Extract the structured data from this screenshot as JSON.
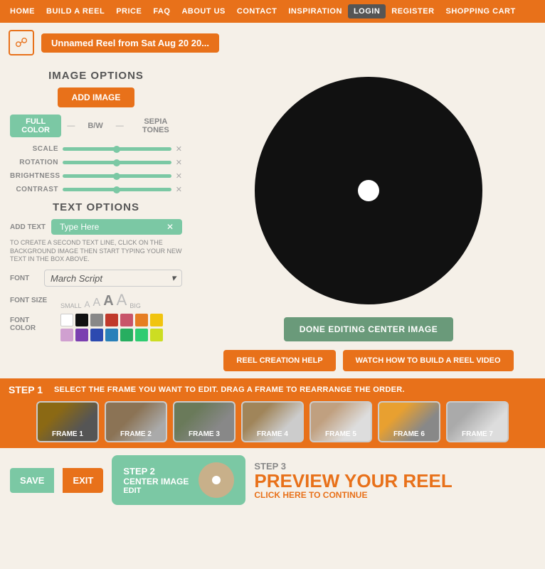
{
  "nav": {
    "items": [
      {
        "label": "HOME",
        "active": false
      },
      {
        "label": "BUILD A REEL",
        "active": false
      },
      {
        "label": "PRICE",
        "active": false
      },
      {
        "label": "FAQ",
        "active": false
      },
      {
        "label": "ABOUT US",
        "active": false
      },
      {
        "label": "CONTACT",
        "active": false
      },
      {
        "label": "INSPIRATION",
        "active": false
      },
      {
        "label": "LOGIN",
        "active": true
      },
      {
        "label": "REGISTER",
        "active": false
      },
      {
        "label": "SHOPPING CART",
        "active": false
      }
    ]
  },
  "top_bar": {
    "reel_title": "Unnamed Reel from Sat Aug 20 20..."
  },
  "left_panel": {
    "image_options_title": "IMAGE OPTIONS",
    "add_image_label": "ADD IMAGE",
    "color_options": {
      "full_color": "FULL COLOR",
      "bw": "B/W",
      "sepia": "SEPIA TONES"
    },
    "sliders": [
      {
        "label": "SCALE"
      },
      {
        "label": "ROTATION"
      },
      {
        "label": "BRIGHTNESS"
      },
      {
        "label": "CONTRAST"
      }
    ],
    "text_options_title": "TEXT OPTIONS",
    "add_text_label": "ADD TEXT",
    "type_here_placeholder": "Type Here",
    "hint": "TO CREATE A SECOND TEXT LINE, CLICK ON THE BACKGROUND IMAGE THEN START TYPING YOUR NEW TEXT IN THE BOX ABOVE.",
    "font_label": "FONT",
    "font_name": "March Script",
    "font_size_label": "FONT SIZE",
    "font_size_small": "SMALL",
    "font_size_big": "BIG",
    "font_color_label": "FONT COLOR",
    "color_swatches_row1": [
      "#ffffff",
      "#111111",
      "#888888",
      "#c0392b",
      "#8e44ad",
      "#e67e22"
    ],
    "color_swatches_row2": [
      "#f1c40f",
      "#9b59b6",
      "#2980b9",
      "#27ae60",
      "#1abc9c",
      "#e8711a"
    ],
    "color_swatches_row3": [
      "#c8a0d0",
      "#7b3fb0",
      "#2c3e90",
      "#27ae60",
      "#2ecc71",
      "#ccdd22"
    ]
  },
  "right_panel": {
    "done_editing_label": "DONE EDITING CENTER IMAGE",
    "reel_help_label": "REEL CREATION HELP",
    "watch_video_label": "WATCH HOW TO BUILD A REEL VIDEO"
  },
  "step1": {
    "label": "STEP 1",
    "instruction": "SELECT THE FRAME YOU WANT TO EDIT. DRAG A FRAME TO REARRANGE THE ORDER.",
    "frames": [
      {
        "label": "FRAME 1"
      },
      {
        "label": "FRAME 2"
      },
      {
        "label": "FRAME 3"
      },
      {
        "label": "FRAME 4"
      },
      {
        "label": "FRAME 5"
      },
      {
        "label": "FRAME 6"
      },
      {
        "label": "FRAME 7"
      }
    ]
  },
  "bottom": {
    "save_label": "SAVE",
    "exit_label": "EXIT",
    "step2_number": "STEP 2",
    "step2_title": "CENTER IMAGE",
    "step2_sub": "EDIT",
    "step3_number": "STEP 3",
    "step3_title": "PREVIEW YOUR REEL",
    "step3_sub": "CLICK HERE TO CONTINUE"
  }
}
